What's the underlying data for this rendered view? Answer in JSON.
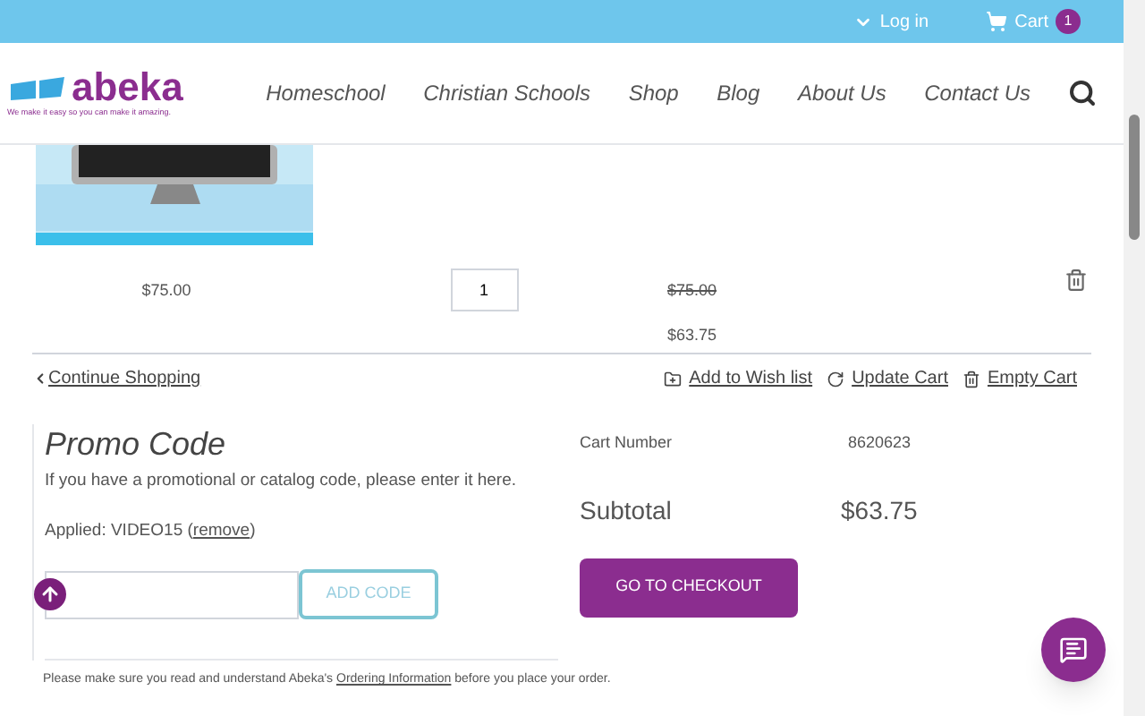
{
  "top_bar": {
    "login": "Log in",
    "cart": "Cart",
    "cart_count": "1"
  },
  "header": {
    "logo": "abeka",
    "tagline": "We make it easy so you can make it amazing.",
    "nav": [
      "Homeschool",
      "Christian Schools",
      "Shop",
      "Blog",
      "About Us",
      "Contact Us"
    ]
  },
  "cart_item": {
    "price": "$75.00",
    "quantity": "1",
    "original_total": "$75.00",
    "total": "$63.75"
  },
  "cart_actions": {
    "continue": "Continue Shopping",
    "wishlist": "Add to Wish list",
    "update": "Update Cart",
    "empty": "Empty Cart"
  },
  "promo": {
    "title": "Promo Code",
    "hint": "If you have a promotional or catalog code, please enter it here.",
    "applied_prefix": "Applied: VIDEO15 (",
    "remove": "remove",
    "applied_suffix": ")",
    "button": "ADD CODE"
  },
  "summary": {
    "cart_number_label": "Cart Number",
    "cart_number": "8620623",
    "subtotal_label": "Subtotal",
    "subtotal": "$63.75",
    "checkout": "GO TO CHECKOUT"
  },
  "notice": {
    "before": "Please make sure you read and understand Abeka's ",
    "link": "Ordering Information",
    "after": " before you place your order."
  }
}
